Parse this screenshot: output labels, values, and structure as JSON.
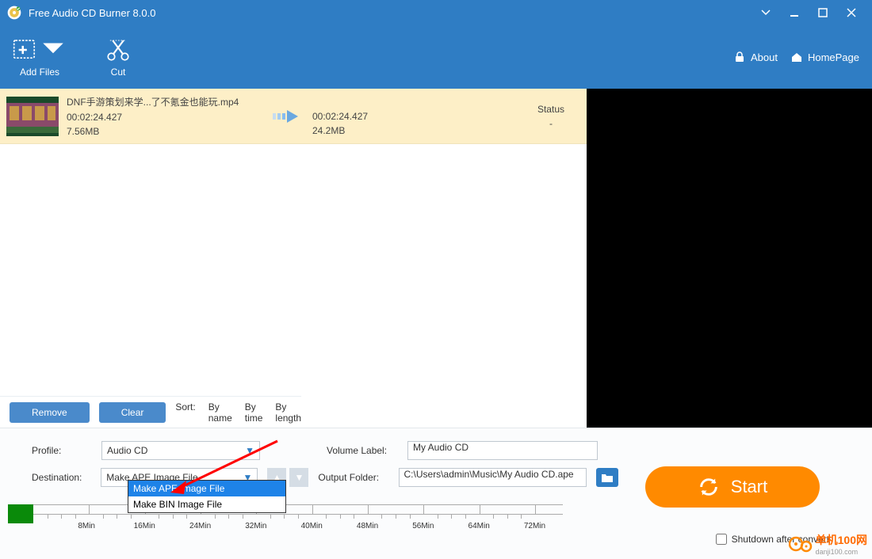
{
  "title": "Free Audio CD Burner 8.0.0",
  "toolbar": {
    "add_files": "Add Files",
    "cut": "Cut",
    "about": "About",
    "homepage": "HomePage"
  },
  "file": {
    "name": "DNF手游策划来学...了不氪金也能玩.mp4",
    "duration": "00:02:24.427",
    "size": "7.56MB",
    "out_duration": "00:02:24.427",
    "out_size": "24.2MB",
    "status_label": "Status",
    "status_value": "-"
  },
  "actions": {
    "remove": "Remove",
    "clear": "Clear",
    "sort": "Sort:",
    "by_name": "By name",
    "by_time": "By time",
    "by_length": "By length"
  },
  "form": {
    "profile_label": "Profile:",
    "profile_value": "Audio CD",
    "destination_label": "Destination:",
    "destination_value": "Make APE Image File",
    "dropdown_options": [
      "Make APE Image File",
      "Make BIN Image File"
    ],
    "volume_label": "Volume Label:",
    "volume_value": "My Audio CD",
    "output_folder_label": "Output Folder:",
    "output_folder_value": "C:\\Users\\admin\\Music\\My Audio CD.ape"
  },
  "timeline": {
    "ticks": [
      "8Min",
      "16Min",
      "24Min",
      "32Min",
      "40Min",
      "48Min",
      "56Min",
      "64Min",
      "72Min"
    ]
  },
  "start": "Start",
  "shutdown": "Shutdown after convert",
  "watermark": {
    "main": "单机100网",
    "sub": "danji100.com"
  }
}
